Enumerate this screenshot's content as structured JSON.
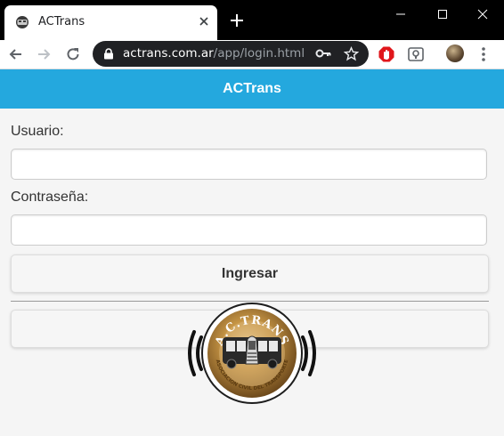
{
  "browser": {
    "tab_title": "ACTrans",
    "url_host": "actrans.com.ar",
    "url_path": "/app/login.html"
  },
  "app": {
    "header_title": "ACTrans",
    "user_label": "Usuario:",
    "user_value": "",
    "password_label": "Contraseña:",
    "password_value": "",
    "login_button": "Ingresar",
    "logo": {
      "top_text": "A.C.TRANS",
      "ring_text": "ASOCIACION CIVIL DEL TRANSPORTE"
    }
  },
  "colors": {
    "header": "#24a8de",
    "tabstrip": "#000000",
    "omnibox": "#202124",
    "logo_gold": "#b98a3a"
  }
}
